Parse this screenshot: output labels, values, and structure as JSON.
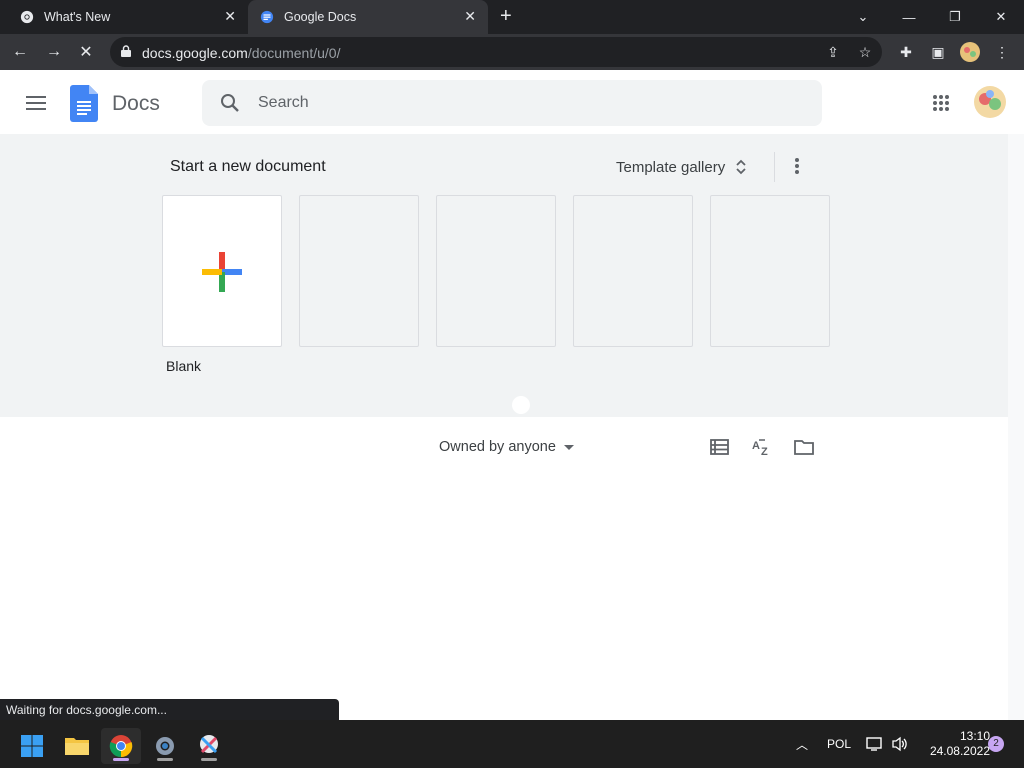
{
  "browser": {
    "tabs": [
      {
        "title": "What's New",
        "active": false
      },
      {
        "title": "Google Docs",
        "active": true
      }
    ],
    "url_host": "docs.google.com",
    "url_path": "/document/u/0/",
    "status_text": "Waiting for docs.google.com..."
  },
  "docs": {
    "app_name": "Docs",
    "search_placeholder": "Search",
    "start_new_label": "Start a new document",
    "template_gallery_label": "Template gallery",
    "templates": [
      {
        "label": "Blank"
      },
      {
        "label": ""
      },
      {
        "label": ""
      },
      {
        "label": ""
      },
      {
        "label": ""
      }
    ],
    "owner_filter": "Owned by anyone"
  },
  "taskbar": {
    "language": "POL",
    "time": "13:10",
    "date": "24.08.2022",
    "notification_count": "2"
  },
  "colors": {
    "docs_blue": "#4285f4",
    "google_red": "#ea4335",
    "google_yellow": "#fbbc04",
    "google_green": "#34a853"
  }
}
